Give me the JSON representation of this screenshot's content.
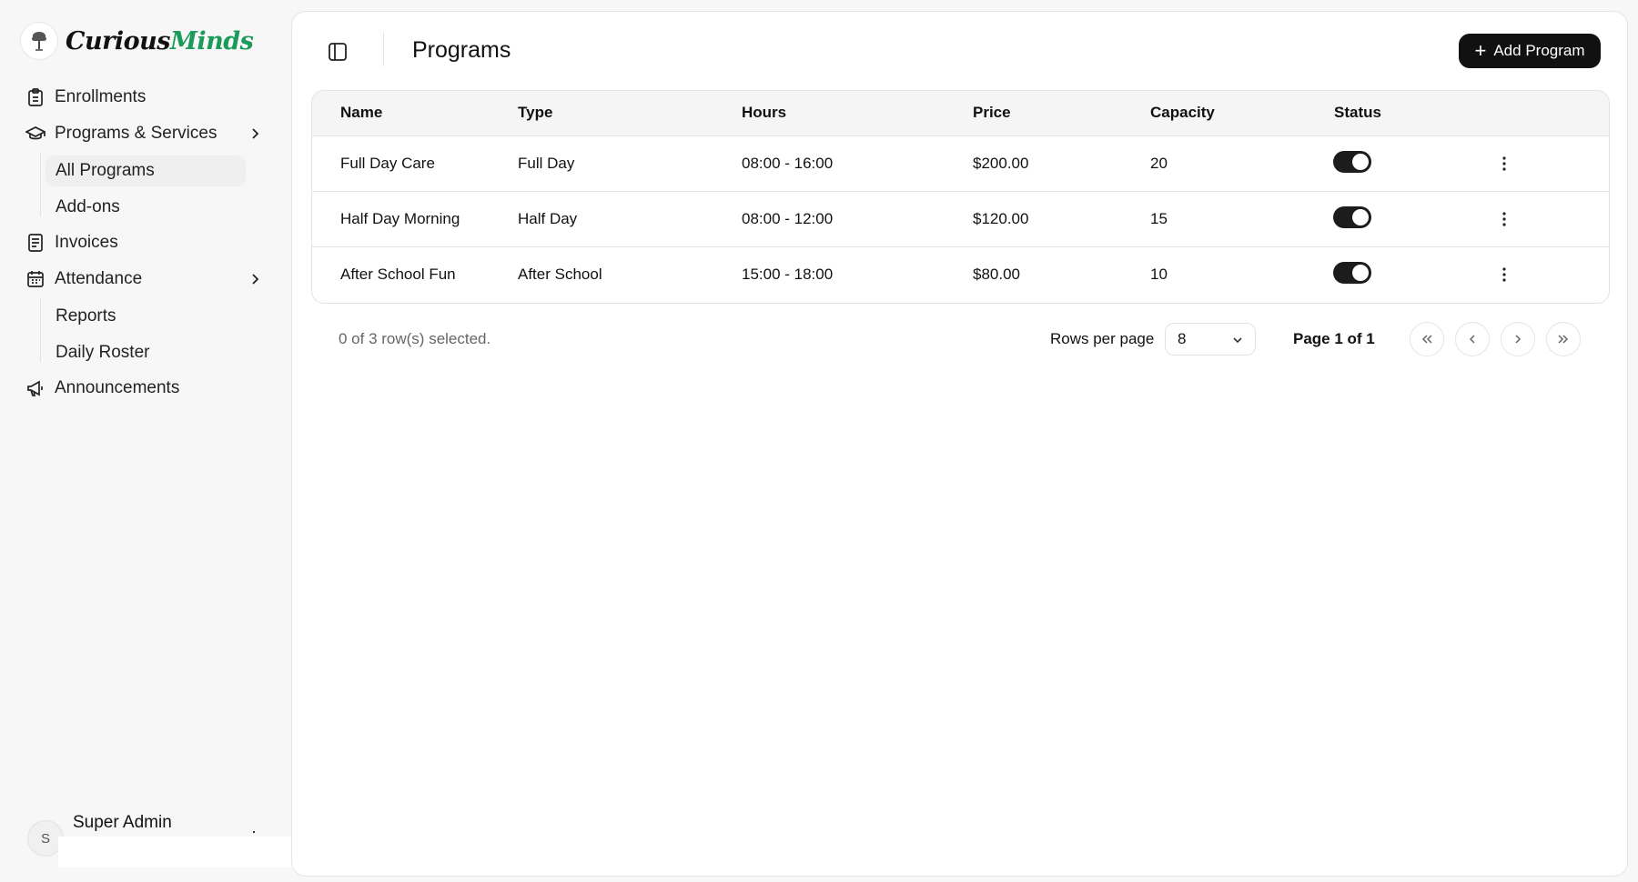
{
  "brand": {
    "name_part1": "Curious",
    "name_part2": "Minds"
  },
  "sidebar": {
    "items": [
      {
        "label": "Enrollments",
        "icon": "clipboard-icon"
      },
      {
        "label": "Programs & Services",
        "icon": "graduation-cap-icon",
        "expandable": true
      },
      {
        "label": "Invoices",
        "icon": "receipt-icon"
      },
      {
        "label": "Attendance",
        "icon": "calendar-icon",
        "expandable": true
      },
      {
        "label": "Announcements",
        "icon": "megaphone-icon"
      }
    ],
    "programs_sub": [
      "All Programs",
      "Add-ons"
    ],
    "attendance_sub": [
      "Reports",
      "Daily Roster"
    ],
    "active_sub": "All Programs"
  },
  "user": {
    "initial": "S",
    "name": "Super Admin"
  },
  "header": {
    "title": "Programs",
    "add_button": "Add Program"
  },
  "table": {
    "columns": [
      "Name",
      "Type",
      "Hours",
      "Price",
      "Capacity",
      "Status"
    ],
    "rows": [
      {
        "name": "Full Day Care",
        "type": "Full Day",
        "hours": "08:00 - 16:00",
        "price": "$200.00",
        "capacity": "20",
        "status": true
      },
      {
        "name": "Half Day Morning",
        "type": "Half Day",
        "hours": "08:00 - 12:00",
        "price": "$120.00",
        "capacity": "15",
        "status": true
      },
      {
        "name": "After School Fun",
        "type": "After School",
        "hours": "15:00 - 18:00",
        "price": "$80.00",
        "capacity": "10",
        "status": true
      }
    ]
  },
  "footer": {
    "selection": "0 of 3 row(s) selected.",
    "rows_per_page_label": "Rows per page",
    "rows_per_page_value": "8",
    "page_info": "Page 1 of 1"
  }
}
